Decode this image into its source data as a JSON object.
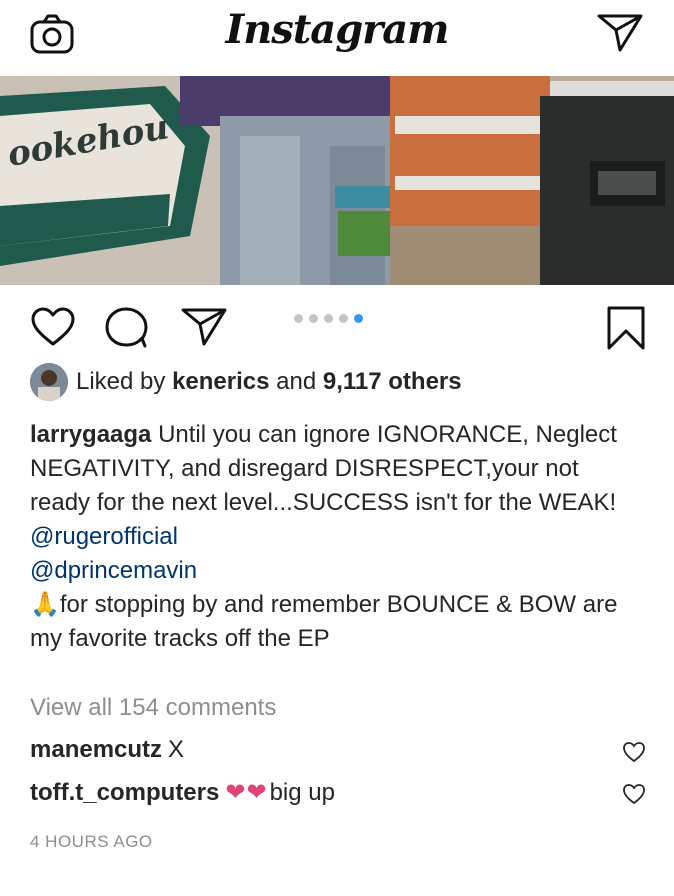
{
  "header": {
    "logo_text": "Instagram",
    "camera_icon": "camera-icon",
    "direct_icon": "paper-plane-icon"
  },
  "photo": {
    "description_icon": "post-image",
    "sign_text": "ookehou"
  },
  "actions": {
    "like_icon": "heart-icon",
    "comment_icon": "comment-bubble-icon",
    "share_icon": "paper-plane-icon",
    "save_icon": "bookmark-icon",
    "carousel_total": 5,
    "carousel_active_index": 5
  },
  "likes": {
    "prefix": "Liked by",
    "user": "kenerics",
    "middle": "and",
    "count": "9,117 others"
  },
  "caption": {
    "username": "larrygaaga",
    "text": "Until you can ignore IGNORANCE, Neglect NEGATIVITY, and disregard DISRESPECT,your not ready for the next level...SUCCESS isn't for the WEAK!",
    "mentions": [
      "@rugerofficial",
      "@dprincemavin"
    ],
    "emoji": "🙏",
    "closing": "for stopping by and remember BOUNCE & BOW are my favorite tracks off the EP"
  },
  "view_all_comments": "View all 154 comments",
  "comments": [
    {
      "username": "manemcutz",
      "text": "X",
      "hearts": ""
    },
    {
      "username": "toff.t_computers",
      "text": "big up",
      "hearts": "❤❤"
    }
  ],
  "timestamp": "4 HOURS AGO",
  "colors": {
    "link": "#003569",
    "muted": "#8e8e8e",
    "active_dot": "#3897f0",
    "pink_heart": "#e0457a"
  }
}
